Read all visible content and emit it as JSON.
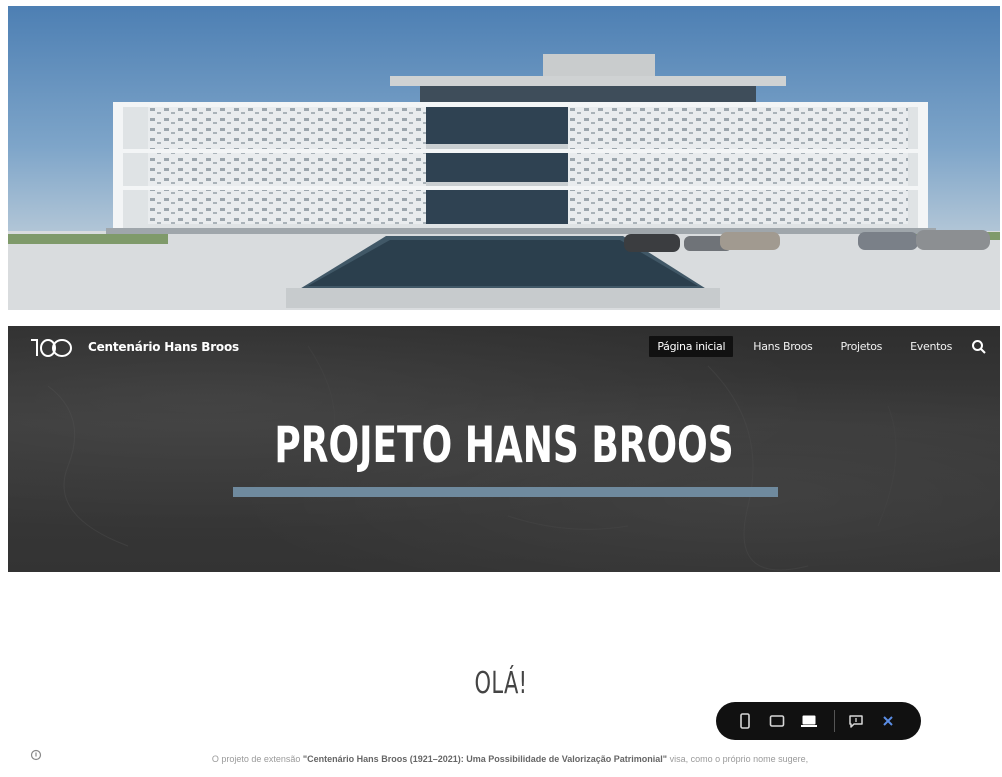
{
  "site": {
    "title": "Centenário Hans Broos",
    "logo_text": "100"
  },
  "nav": {
    "items": [
      {
        "label": "Página inicial",
        "active": true
      },
      {
        "label": "Hans Broos",
        "active": false
      },
      {
        "label": "Projetos",
        "active": false
      },
      {
        "label": "Eventos",
        "active": false
      }
    ],
    "search_icon": "search-icon"
  },
  "hero": {
    "title": "PROJETO HANS BROOS",
    "bar_color": "#6f8a9e"
  },
  "content": {
    "heading": "OLÁ!",
    "intro_prefix": "O projeto de extensão ",
    "intro_bold": "\"Centenário Hans Broos (1921–2021): Uma Possibilidade de Valorização Patrimonial\"",
    "intro_suffix": " visa, como o próprio nome sugere,"
  },
  "toolbar": {
    "buttons": [
      "phone-view-icon",
      "tablet-view-icon",
      "desktop-view-icon",
      "comment-icon",
      "close-icon"
    ]
  }
}
